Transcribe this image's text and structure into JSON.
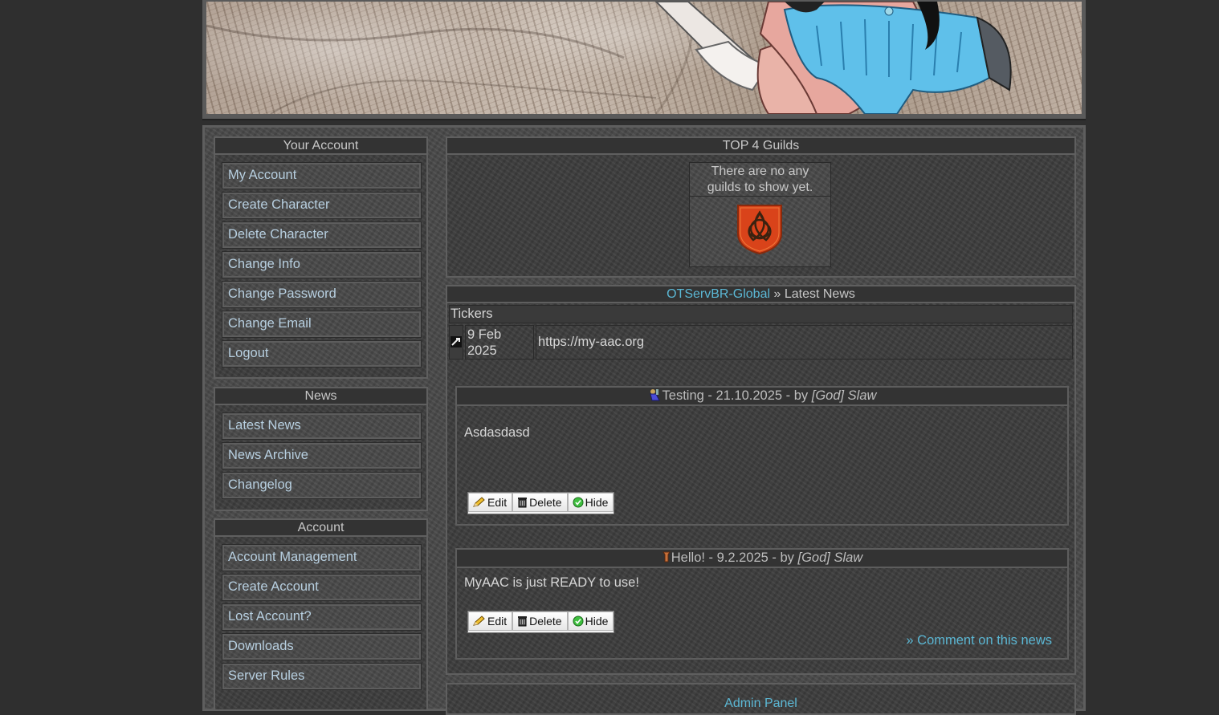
{
  "sidebar": {
    "sections": [
      {
        "title": "Your Account",
        "items": [
          "My Account",
          "Create Character",
          "Delete Character",
          "Change Info",
          "Change Password",
          "Change Email",
          "Logout"
        ]
      },
      {
        "title": "News",
        "items": [
          "Latest News",
          "News Archive",
          "Changelog"
        ]
      },
      {
        "title": "Account",
        "items": [
          "Account Management",
          "Create Account",
          "Lost Account?",
          "Downloads",
          "Server Rules"
        ]
      }
    ]
  },
  "guilds": {
    "title": "TOP 4 Guilds",
    "empty_line1": "There are no any",
    "empty_line2": "guilds to show yet."
  },
  "news": {
    "site_link": "OTServBR-Global",
    "separator": " » ",
    "page_title": "Latest News",
    "tickers_label": "Tickers",
    "ticker": {
      "date_line1": "9 Feb",
      "date_line2": "2025",
      "text": "https://my-aac.org"
    },
    "articles": [
      {
        "title": "Testing - 21.10.2025 - by ",
        "author": "[God] Slaw",
        "body": "Asdasdasd",
        "comment_link": ""
      },
      {
        "title": "Hello! - 9.2.2025 - by ",
        "author": "[God] Slaw",
        "body": "MyAAC is just READY to use!",
        "comment_link": "» Comment on this news"
      }
    ],
    "buttons": {
      "edit": "Edit",
      "delete": "Delete",
      "hide": "Hide"
    }
  },
  "admin_panel": {
    "title": "Admin Panel"
  },
  "colors": {
    "link": "#5bb7d4",
    "menu_text": "#b7cfe0",
    "background": "#2f2f2f"
  }
}
